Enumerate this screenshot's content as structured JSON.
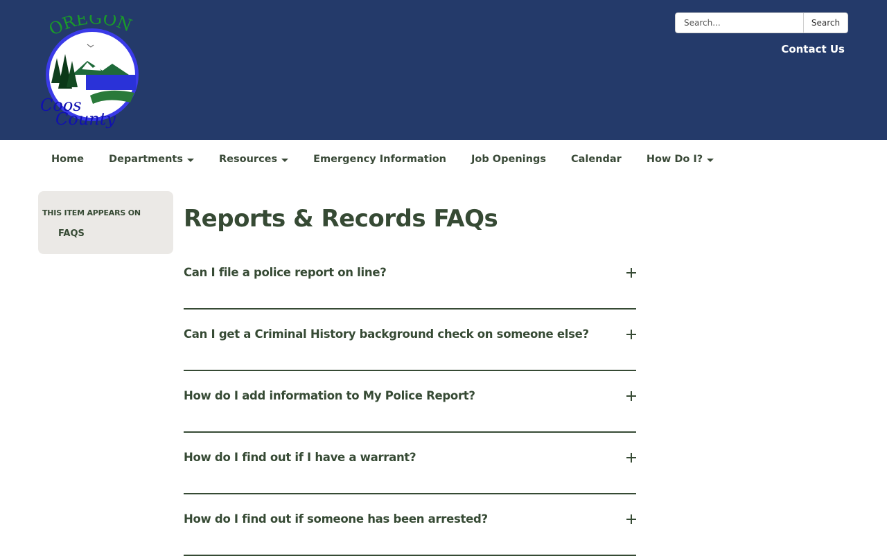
{
  "header": {
    "logo": {
      "top_text": "OREGON",
      "bottom_line1": "Coos",
      "bottom_line2": "County"
    },
    "search": {
      "placeholder": "Search...",
      "button_label": "Search"
    },
    "contact_label": "Contact Us"
  },
  "nav": {
    "items": [
      {
        "label": "Home",
        "has_dropdown": false
      },
      {
        "label": "Departments",
        "has_dropdown": true
      },
      {
        "label": "Resources",
        "has_dropdown": true
      },
      {
        "label": "Emergency Information",
        "has_dropdown": false
      },
      {
        "label": "Job Openings",
        "has_dropdown": false
      },
      {
        "label": "Calendar",
        "has_dropdown": false
      },
      {
        "label": "How Do I?",
        "has_dropdown": true
      }
    ]
  },
  "sidebar": {
    "heading": "THIS ITEM APPEARS ON",
    "link": "FAQS"
  },
  "main": {
    "title": "Reports & Records FAQs",
    "faqs": [
      {
        "question": "Can I file a police report on line?"
      },
      {
        "question": "Can I get a Criminal History background check on someone else?"
      },
      {
        "question": "How do I add information to My Police Report?"
      },
      {
        "question": "How do I find out if I have a warrant?"
      },
      {
        "question": "How do I find out if someone has been arrested?"
      }
    ]
  },
  "colors": {
    "header_bg": "#243a6a",
    "text_green": "#364a34",
    "sidebar_bg": "#ebe9e6"
  }
}
